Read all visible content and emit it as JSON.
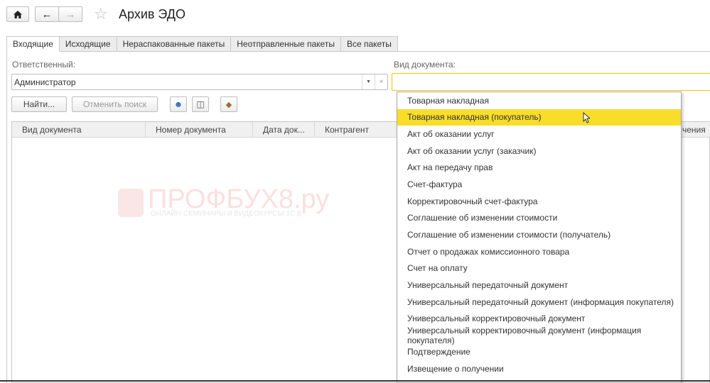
{
  "header": {
    "title": "Архив ЭДО",
    "home_icon": "home-icon",
    "back_icon": "arrow-left-icon",
    "forward_icon": "arrow-right-icon",
    "favorite_icon": "star-icon"
  },
  "tabs": [
    {
      "label": "Входящие",
      "active": true
    },
    {
      "label": "Исходящие"
    },
    {
      "label": "Нераспакованные пакеты"
    },
    {
      "label": "Неотправленные пакеты"
    },
    {
      "label": "Все пакеты"
    }
  ],
  "filters": {
    "responsible_label": "Ответственный:",
    "responsible_value": "Администратор",
    "doc_type_label": "Вид документа:",
    "doc_type_value": ""
  },
  "toolbar": {
    "find": "Найти...",
    "cancel_search": "Отменить поиск"
  },
  "table": {
    "columns": [
      "Вид документа",
      "Номер документа",
      "Дата док...",
      "Контрагент",
      "чения"
    ]
  },
  "watermark": {
    "title": "ПРОФБУХ8.ру",
    "subtitle": "ОНЛАЙН-СЕМИНАРЫ И ВИДЕОКУРСЫ 1С:8"
  },
  "dropdown": {
    "items": [
      "Товарная накладная",
      "Товарная накладная (покупатель)",
      "Акт об оказании услуг",
      "Акт об оказании услуг (заказчик)",
      "Акт на передачу прав",
      "Счет-фактура",
      "Корректировочный счет-фактура",
      "Соглашение об изменении стоимости",
      "Соглашение об изменении стоимости (получатель)",
      "Отчет о продажах комиссионного товара",
      "Счет на оплату",
      "Универсальный передаточный документ",
      "Универсальный передаточный документ (информация покупателя)",
      "Универсальный корректировочный документ",
      "Универсальный корректировочный документ (информация покупателя)",
      "Подтверждение",
      "Извещение о получении"
    ],
    "selected_index": 1,
    "highlight_color": "#f8dd2a"
  }
}
